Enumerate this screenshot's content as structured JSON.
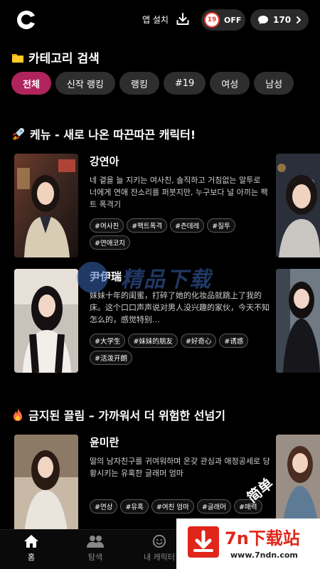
{
  "header": {
    "install_label": "앱 설치",
    "age_badge": "19",
    "age_toggle": "OFF",
    "credits": "170"
  },
  "category": {
    "title": "카테고리 검색",
    "chips": [
      "전체",
      "신작 랭킹",
      "랭킹",
      "#19",
      "여성",
      "남성"
    ]
  },
  "section_new": {
    "title": "케뉴 - 새로 나온 따끈따끈 캐릭터!",
    "cards": [
      {
        "name": "강연아",
        "desc": "네 곁을 늘 지키는 여사친, 솔직하고 거침없는 말투로 너에게 연애 잔소리를 퍼붓지만, 누구보다 널 아끼는 팩트 폭격기",
        "tags": [
          "#여사친",
          "#팩트폭격",
          "#츤데레",
          "#질투",
          "#연애코치"
        ]
      },
      {
        "name": "尹伊瑞",
        "desc": "妹妹十年的闺蜜，打碎了她的化妆品就跳上了我的床。这个口口声声说对男人没兴趣的家伙，今天不知怎么的，感觉特别…",
        "tags": [
          "#大学生",
          "#妹妹的朋友",
          "#好奇心",
          "#诱惑",
          "#活泼开朗"
        ]
      }
    ]
  },
  "section_forbidden": {
    "title": "금지된 끌림 – 가까워서 더 위험한 선넘기",
    "cards": [
      {
        "name": "윤미란",
        "desc": "딸의 남자친구를 귀여워하며 온갖 관심과 애정공세로 당황시키는 유혹한 글래머 엄마",
        "tags": [
          "#연상",
          "#유혹",
          "#여친 엄마",
          "#글래머",
          "#매력"
        ]
      }
    ]
  },
  "bottom_nav": {
    "items": [
      "홈",
      "탐색",
      "내 캐릭터"
    ]
  },
  "watermark": {
    "main": "7n下载站",
    "url": "www.7ndn.com",
    "center": "精品下载",
    "vertical": "简单"
  },
  "colors": {
    "accent": "#b0245e",
    "background": "#000000",
    "chip": "#2e2e2e"
  }
}
